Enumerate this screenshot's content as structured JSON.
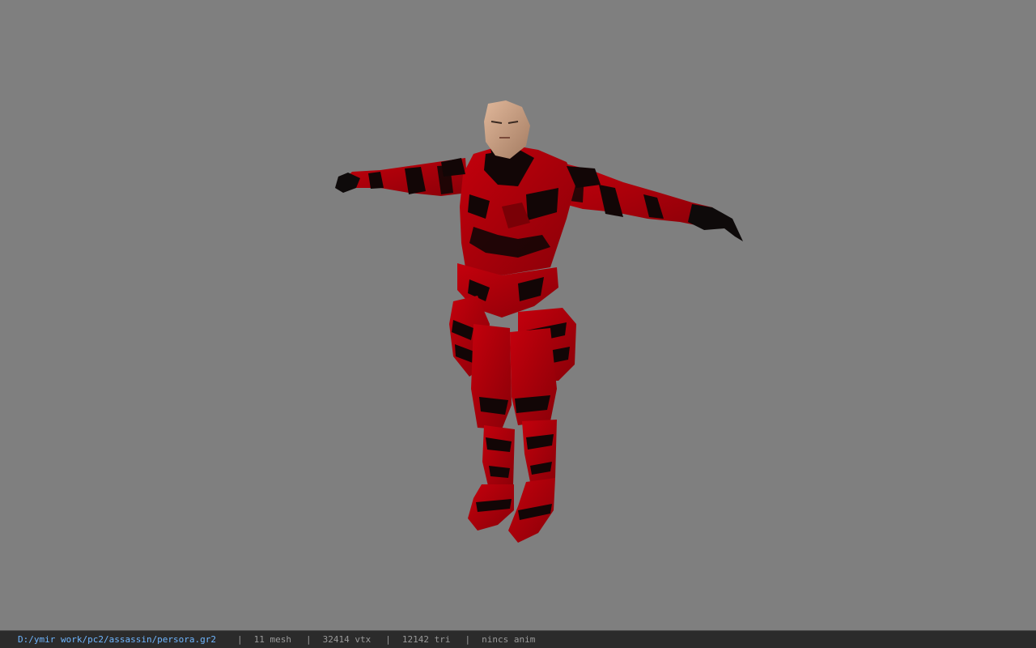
{
  "viewport": {
    "background": "#7f7f7f",
    "model_name": "persora"
  },
  "status_bar": {
    "file_path": "D:/ymir work/pc2/assassin/persora.gr2",
    "separator": "|",
    "mesh": "11 mesh",
    "vertices": "32414 vtx",
    "triangles": "12142 tri",
    "anim": "nincs anim",
    "path_color": "#6fb6ff",
    "text_color": "#9a9a9a"
  },
  "colors": {
    "armor_red": "#b3000a",
    "armor_dark": "#120606",
    "skin": "#c9a488"
  }
}
